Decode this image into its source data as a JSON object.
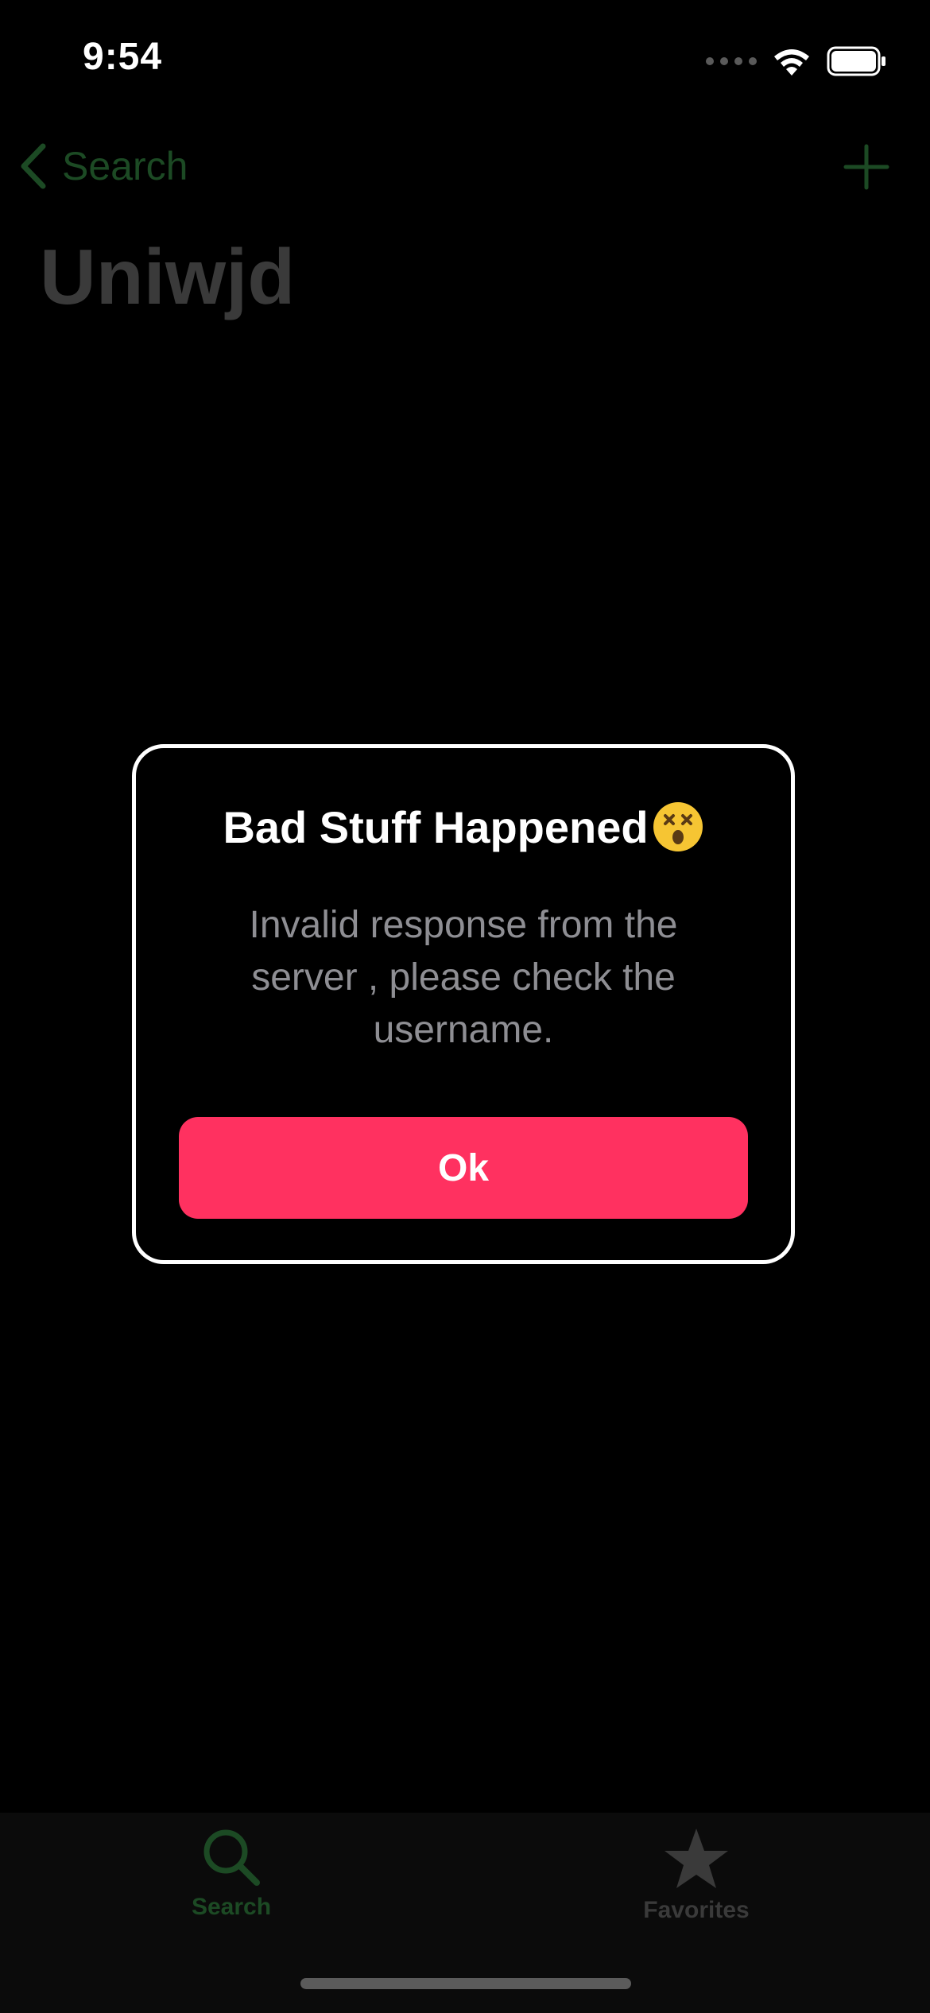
{
  "status_bar": {
    "time": "9:54",
    "icons": [
      "cellular-signal-icon",
      "wifi-icon",
      "battery-icon"
    ]
  },
  "nav": {
    "back_label": "Search",
    "title": "Uniwjd",
    "add_icon": "plus-icon"
  },
  "alert": {
    "title": "Bad Stuff Happened",
    "emoji": "dizzy-face-emoji",
    "message": "Invalid response from the server , please check the username.",
    "button_label": "Ok"
  },
  "tab_bar": {
    "tabs": [
      {
        "label": "Search",
        "icon": "magnifying-glass-icon",
        "selected": true
      },
      {
        "label": "Favorites",
        "icon": "star-icon",
        "selected": false
      }
    ]
  },
  "colors": {
    "background": "#000000",
    "accent_dimmed": "#1c4a24",
    "button": "#ff3160",
    "alert_border": "#ffffff",
    "message_text": "#8e8e93"
  }
}
